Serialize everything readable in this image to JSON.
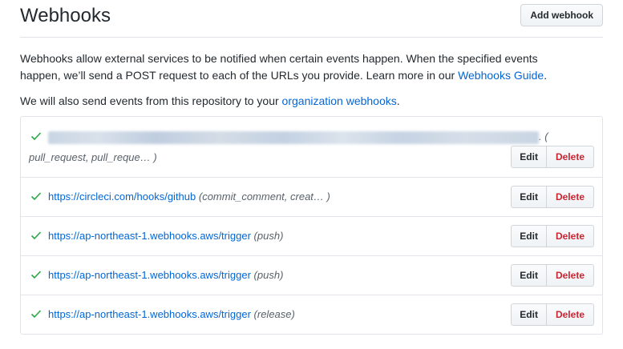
{
  "header": {
    "title": "Webhooks",
    "add_button_label": "Add webhook"
  },
  "intro": {
    "line1_text": "Webhooks allow external services to be notified when certain events happen. When the specified events happen, we’ll send a POST request to each of the URLs you provide. Learn more in our ",
    "guide_link": "Webhooks Guide",
    "line1_end": ".",
    "line2_text": "We will also send events from this repository to your ",
    "org_link": "organization webhooks",
    "line2_end": "."
  },
  "webhooks": [
    {
      "url": "",
      "url_redacted": true,
      "suffix": ". (",
      "events": "pull_request, pull_reque… )",
      "status": "success"
    },
    {
      "url": "https://circleci.com/hooks/github",
      "events": "(commit_comment, creat… )",
      "status": "success"
    },
    {
      "url": "https://ap-northeast-1.webhooks.aws/trigger",
      "events": "(push)",
      "status": "success"
    },
    {
      "url": "https://ap-northeast-1.webhooks.aws/trigger",
      "events": "(push)",
      "status": "success"
    },
    {
      "url": "https://ap-northeast-1.webhooks.aws/trigger",
      "events": "(release)",
      "status": "success"
    }
  ],
  "row_actions": {
    "edit_label": "Edit",
    "delete_label": "Delete"
  },
  "colors": {
    "link": "#0366d6",
    "success": "#28a745",
    "danger": "#cb2431"
  }
}
